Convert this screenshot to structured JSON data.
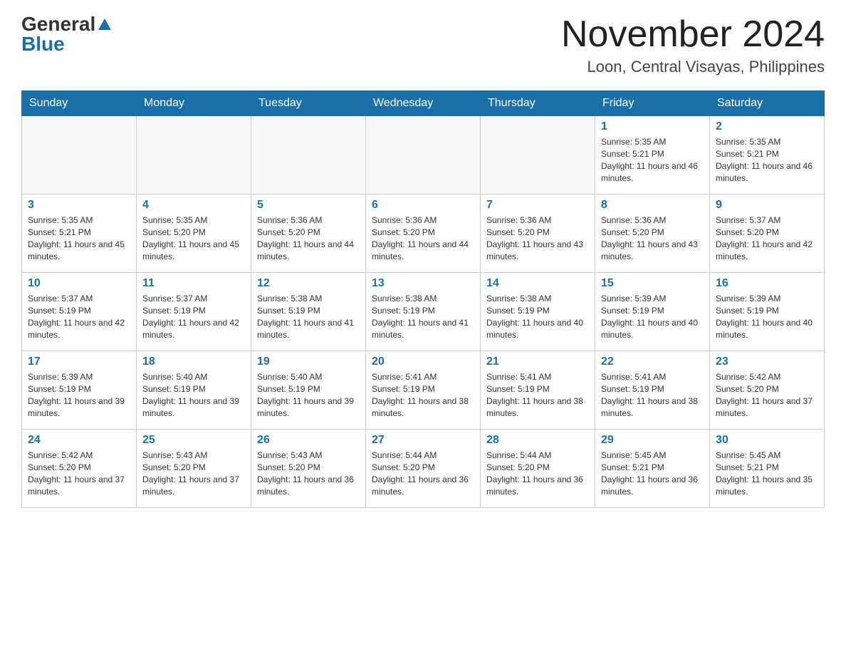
{
  "logo": {
    "general": "General",
    "blue": "Blue"
  },
  "header": {
    "month_title": "November 2024",
    "location": "Loon, Central Visayas, Philippines"
  },
  "weekdays": [
    "Sunday",
    "Monday",
    "Tuesday",
    "Wednesday",
    "Thursday",
    "Friday",
    "Saturday"
  ],
  "weeks": [
    [
      {
        "day": "",
        "info": ""
      },
      {
        "day": "",
        "info": ""
      },
      {
        "day": "",
        "info": ""
      },
      {
        "day": "",
        "info": ""
      },
      {
        "day": "",
        "info": ""
      },
      {
        "day": "1",
        "info": "Sunrise: 5:35 AM\nSunset: 5:21 PM\nDaylight: 11 hours and 46 minutes."
      },
      {
        "day": "2",
        "info": "Sunrise: 5:35 AM\nSunset: 5:21 PM\nDaylight: 11 hours and 46 minutes."
      }
    ],
    [
      {
        "day": "3",
        "info": "Sunrise: 5:35 AM\nSunset: 5:21 PM\nDaylight: 11 hours and 45 minutes."
      },
      {
        "day": "4",
        "info": "Sunrise: 5:35 AM\nSunset: 5:20 PM\nDaylight: 11 hours and 45 minutes."
      },
      {
        "day": "5",
        "info": "Sunrise: 5:36 AM\nSunset: 5:20 PM\nDaylight: 11 hours and 44 minutes."
      },
      {
        "day": "6",
        "info": "Sunrise: 5:36 AM\nSunset: 5:20 PM\nDaylight: 11 hours and 44 minutes."
      },
      {
        "day": "7",
        "info": "Sunrise: 5:36 AM\nSunset: 5:20 PM\nDaylight: 11 hours and 43 minutes."
      },
      {
        "day": "8",
        "info": "Sunrise: 5:36 AM\nSunset: 5:20 PM\nDaylight: 11 hours and 43 minutes."
      },
      {
        "day": "9",
        "info": "Sunrise: 5:37 AM\nSunset: 5:20 PM\nDaylight: 11 hours and 42 minutes."
      }
    ],
    [
      {
        "day": "10",
        "info": "Sunrise: 5:37 AM\nSunset: 5:19 PM\nDaylight: 11 hours and 42 minutes."
      },
      {
        "day": "11",
        "info": "Sunrise: 5:37 AM\nSunset: 5:19 PM\nDaylight: 11 hours and 42 minutes."
      },
      {
        "day": "12",
        "info": "Sunrise: 5:38 AM\nSunset: 5:19 PM\nDaylight: 11 hours and 41 minutes."
      },
      {
        "day": "13",
        "info": "Sunrise: 5:38 AM\nSunset: 5:19 PM\nDaylight: 11 hours and 41 minutes."
      },
      {
        "day": "14",
        "info": "Sunrise: 5:38 AM\nSunset: 5:19 PM\nDaylight: 11 hours and 40 minutes."
      },
      {
        "day": "15",
        "info": "Sunrise: 5:39 AM\nSunset: 5:19 PM\nDaylight: 11 hours and 40 minutes."
      },
      {
        "day": "16",
        "info": "Sunrise: 5:39 AM\nSunset: 5:19 PM\nDaylight: 11 hours and 40 minutes."
      }
    ],
    [
      {
        "day": "17",
        "info": "Sunrise: 5:39 AM\nSunset: 5:19 PM\nDaylight: 11 hours and 39 minutes."
      },
      {
        "day": "18",
        "info": "Sunrise: 5:40 AM\nSunset: 5:19 PM\nDaylight: 11 hours and 39 minutes."
      },
      {
        "day": "19",
        "info": "Sunrise: 5:40 AM\nSunset: 5:19 PM\nDaylight: 11 hours and 39 minutes."
      },
      {
        "day": "20",
        "info": "Sunrise: 5:41 AM\nSunset: 5:19 PM\nDaylight: 11 hours and 38 minutes."
      },
      {
        "day": "21",
        "info": "Sunrise: 5:41 AM\nSunset: 5:19 PM\nDaylight: 11 hours and 38 minutes."
      },
      {
        "day": "22",
        "info": "Sunrise: 5:41 AM\nSunset: 5:19 PM\nDaylight: 11 hours and 38 minutes."
      },
      {
        "day": "23",
        "info": "Sunrise: 5:42 AM\nSunset: 5:20 PM\nDaylight: 11 hours and 37 minutes."
      }
    ],
    [
      {
        "day": "24",
        "info": "Sunrise: 5:42 AM\nSunset: 5:20 PM\nDaylight: 11 hours and 37 minutes."
      },
      {
        "day": "25",
        "info": "Sunrise: 5:43 AM\nSunset: 5:20 PM\nDaylight: 11 hours and 37 minutes."
      },
      {
        "day": "26",
        "info": "Sunrise: 5:43 AM\nSunset: 5:20 PM\nDaylight: 11 hours and 36 minutes."
      },
      {
        "day": "27",
        "info": "Sunrise: 5:44 AM\nSunset: 5:20 PM\nDaylight: 11 hours and 36 minutes."
      },
      {
        "day": "28",
        "info": "Sunrise: 5:44 AM\nSunset: 5:20 PM\nDaylight: 11 hours and 36 minutes."
      },
      {
        "day": "29",
        "info": "Sunrise: 5:45 AM\nSunset: 5:21 PM\nDaylight: 11 hours and 36 minutes."
      },
      {
        "day": "30",
        "info": "Sunrise: 5:45 AM\nSunset: 5:21 PM\nDaylight: 11 hours and 35 minutes."
      }
    ]
  ]
}
